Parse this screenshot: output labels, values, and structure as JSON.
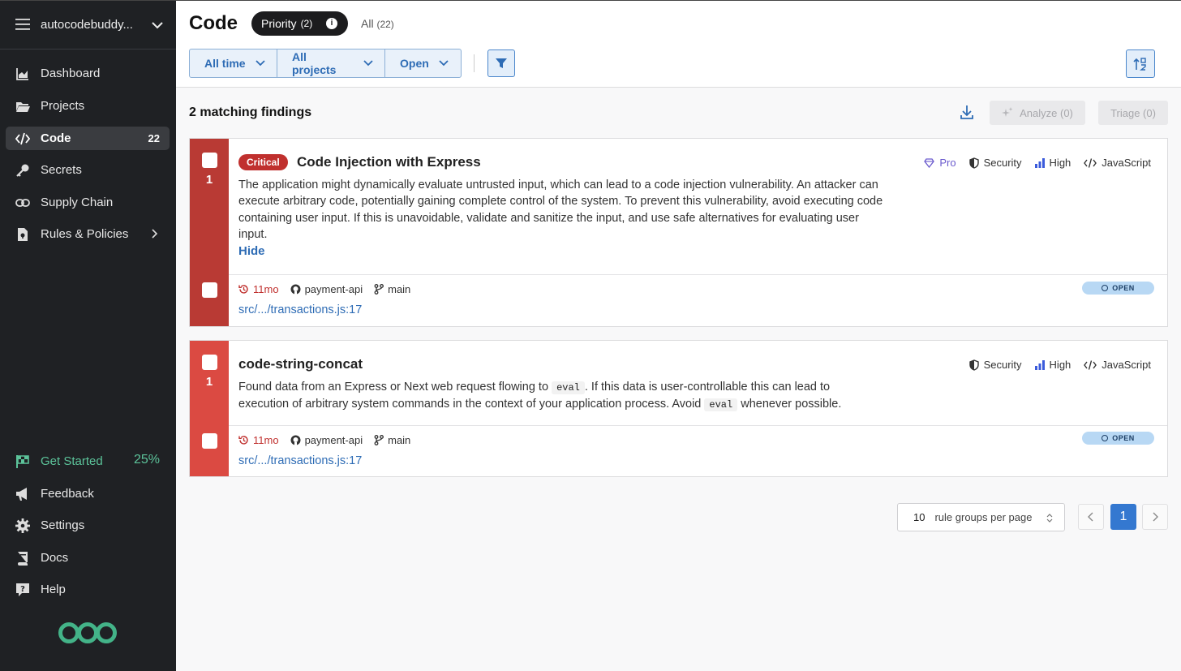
{
  "sidebar": {
    "org_name": "autocodebuddy...",
    "items": [
      {
        "label": "Dashboard"
      },
      {
        "label": "Projects"
      },
      {
        "label": "Code",
        "count": "22"
      },
      {
        "label": "Secrets"
      },
      {
        "label": "Supply Chain"
      },
      {
        "label": "Rules & Policies"
      }
    ],
    "bottom": [
      {
        "label": "Get Started",
        "percent": "25%"
      },
      {
        "label": "Feedback"
      },
      {
        "label": "Settings"
      },
      {
        "label": "Docs"
      },
      {
        "label": "Help"
      }
    ]
  },
  "header": {
    "title": "Code",
    "tab_priority": "Priority",
    "tab_priority_count": "(2)",
    "tab_all": "All",
    "tab_all_count": "(22)",
    "filters": [
      "All time",
      "All projects",
      "Open"
    ]
  },
  "results": {
    "count_label": "2 matching findings",
    "analyze_label": "Analyze (0)",
    "triage_label": "Triage (0)"
  },
  "findings": [
    {
      "count": "1",
      "severity": "Critical",
      "title": "Code Injection with Express",
      "description": "The application might dynamically evaluate untrusted input, which can lead to a code injection vulnerability. An attacker can execute arbitrary code, potentially gaining complete control of the system. To prevent this vulnerability, avoid executing code containing user input. If this is unavoidable, validate and sanitize the input, and use safe alternatives for evaluating user input.",
      "hide_label": "Hide",
      "tags": {
        "pro": "Pro",
        "category": "Security",
        "confidence": "High",
        "language": "JavaScript"
      },
      "age": "11mo",
      "repo": "payment-api",
      "branch": "main",
      "path": "src/.../transactions.js:17",
      "status": "OPEN"
    },
    {
      "count": "1",
      "title": "code-string-concat",
      "description_parts": [
        "Found data from an Express or Next web request flowing to",
        "eval",
        ". If this data is user-controllable this can lead to execution of arbitrary system commands in the context of your application process. Avoid",
        "eval",
        "whenever possible."
      ],
      "tags": {
        "category": "Security",
        "confidence": "High",
        "language": "JavaScript"
      },
      "age": "11mo",
      "repo": "payment-api",
      "branch": "main",
      "path": "src/.../transactions.js:17",
      "status": "OPEN"
    }
  ],
  "pagination": {
    "per_page_value": "10",
    "per_page_label": "rule groups per page",
    "current_page": "1"
  },
  "colors": {
    "sidebar_bg": "#1f2124",
    "critical_bar": "#b93a34",
    "high_bar": "#db4a42",
    "accent_blue": "#2e6cb5",
    "get_started_green": "#5cc39a"
  }
}
